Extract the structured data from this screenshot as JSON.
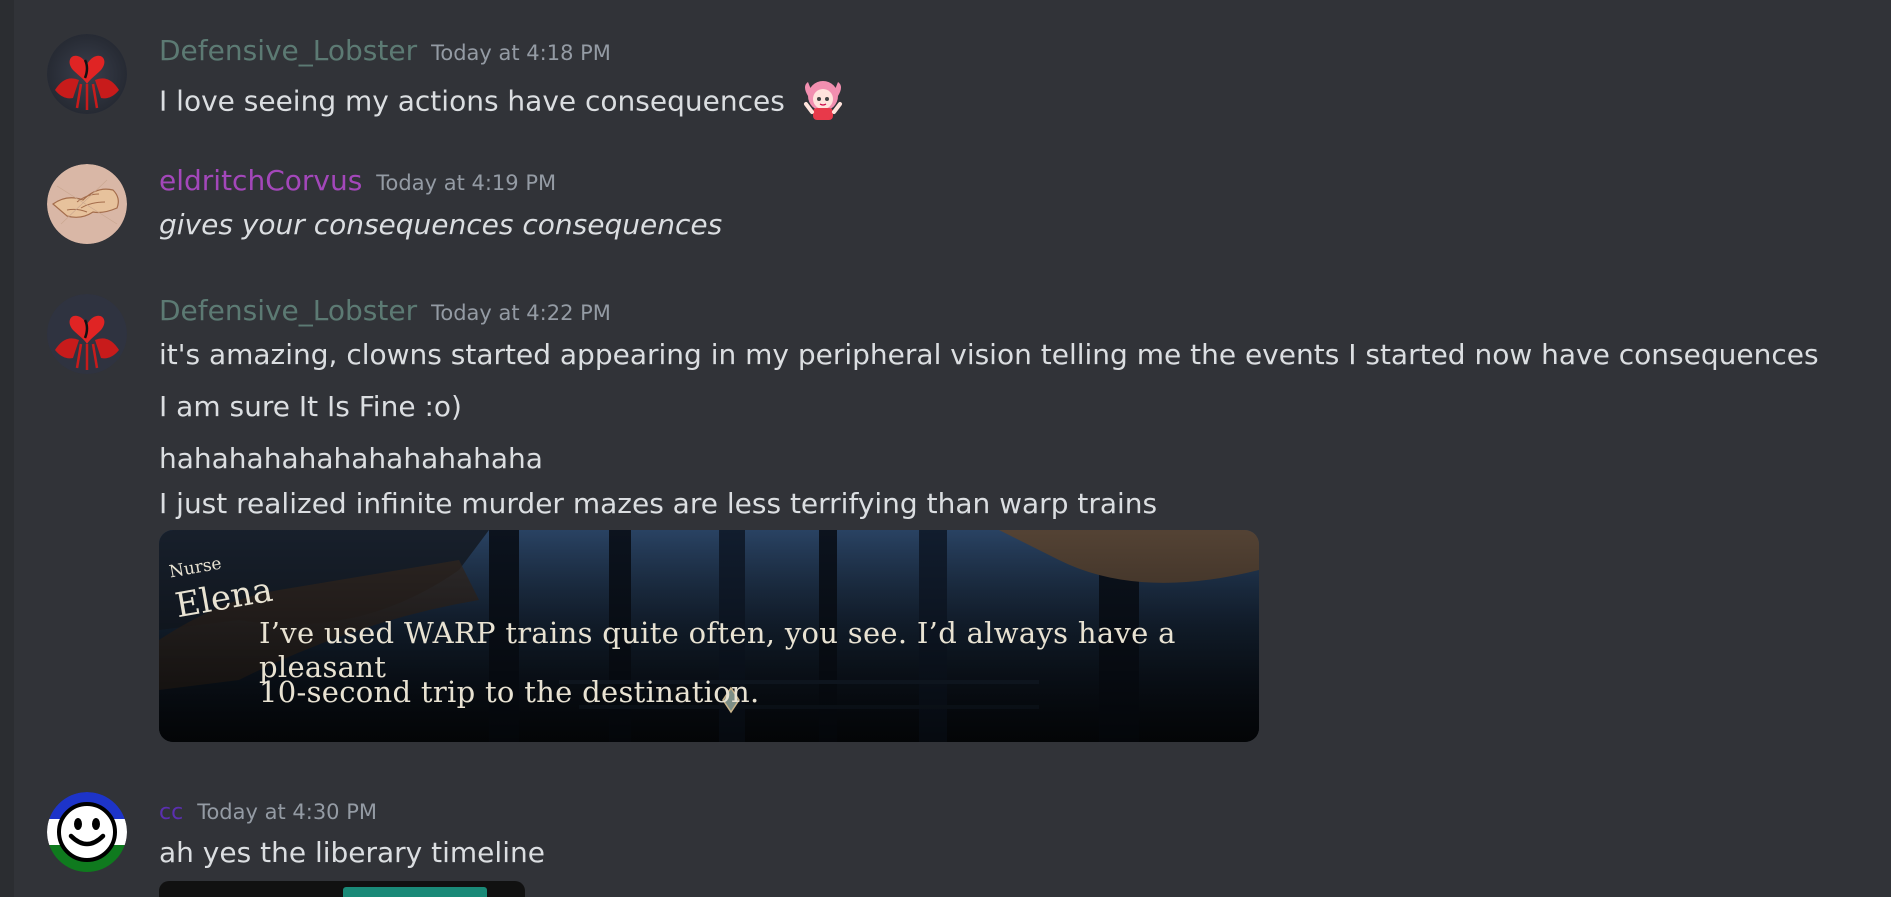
{
  "colors": {
    "background": "#313338",
    "lobster_name": "#5c7a73",
    "corvus_name": "#a347ba",
    "cc_name": "#5b2fb0"
  },
  "messages": [
    {
      "username": "Defensive_Lobster",
      "timestamp": "Today at 4:18 PM",
      "avatar_icon": "red-heart-creature-avatar",
      "lines": [
        "I love seeing my actions have consequences"
      ],
      "emoji": "anime-girl-emoji"
    },
    {
      "username": "eldritchCorvus",
      "timestamp": "Today at 4:19 PM",
      "avatar_icon": "sketch-hand-avatar",
      "lines": [
        "gives your consequences consequences"
      ]
    },
    {
      "username": "Defensive_Lobster",
      "timestamp": "Today at 4:22 PM",
      "avatar_icon": "red-heart-creature-avatar",
      "lines": [
        "it's amazing, clowns started appearing in my peripheral vision telling me the events I started now have consequences",
        "I am sure It Is Fine :o)",
        "hahahahahahahahahahaha",
        "I just realized infinite murder mazes are less terrifying than warp trains"
      ],
      "attachment": {
        "speaker_role": "Nurse",
        "speaker_name": "Elena",
        "dialogue_line1": "I’ve used WARP trains quite often, you see. I’d always have a pleasant",
        "dialogue_line2": "10-second trip to the destination."
      }
    },
    {
      "username": "cc",
      "timestamp": "Today at 4:30 PM",
      "avatar_icon": "smiley-flag-avatar",
      "lines": [
        "ah yes the liberary timeline"
      ]
    }
  ]
}
